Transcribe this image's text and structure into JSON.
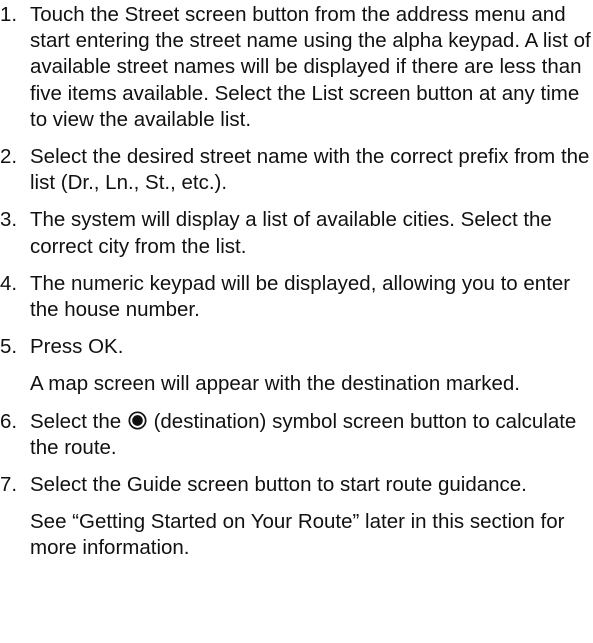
{
  "steps": [
    {
      "number": "1.",
      "text": "Touch the Street screen button from the address menu and start entering the street name using the alpha keypad. A list of available street names will be displayed if there are less than five items available. Select the List screen button at any time to view the available list."
    },
    {
      "number": "2.",
      "text": "Select the desired street name with the correct prefix from the list (Dr., Ln., St., etc.)."
    },
    {
      "number": "3.",
      "text": "The system will display a list of available cities. Select the correct city from the list."
    },
    {
      "number": "4.",
      "text": "The numeric keypad will be displayed, allowing you to enter the house number."
    },
    {
      "number": "5.",
      "text": "Press OK.",
      "note": "A map screen will appear with the destination marked."
    },
    {
      "number": "6.",
      "text_before_icon": "Select the",
      "icon": "destination-symbol-icon",
      "text_after_icon": "(destination) symbol screen button to calculate the route."
    },
    {
      "number": "7.",
      "text": "Select the Guide screen button to start route guidance.",
      "note": "See “Getting Started on Your Route” later in this section for more information."
    }
  ]
}
